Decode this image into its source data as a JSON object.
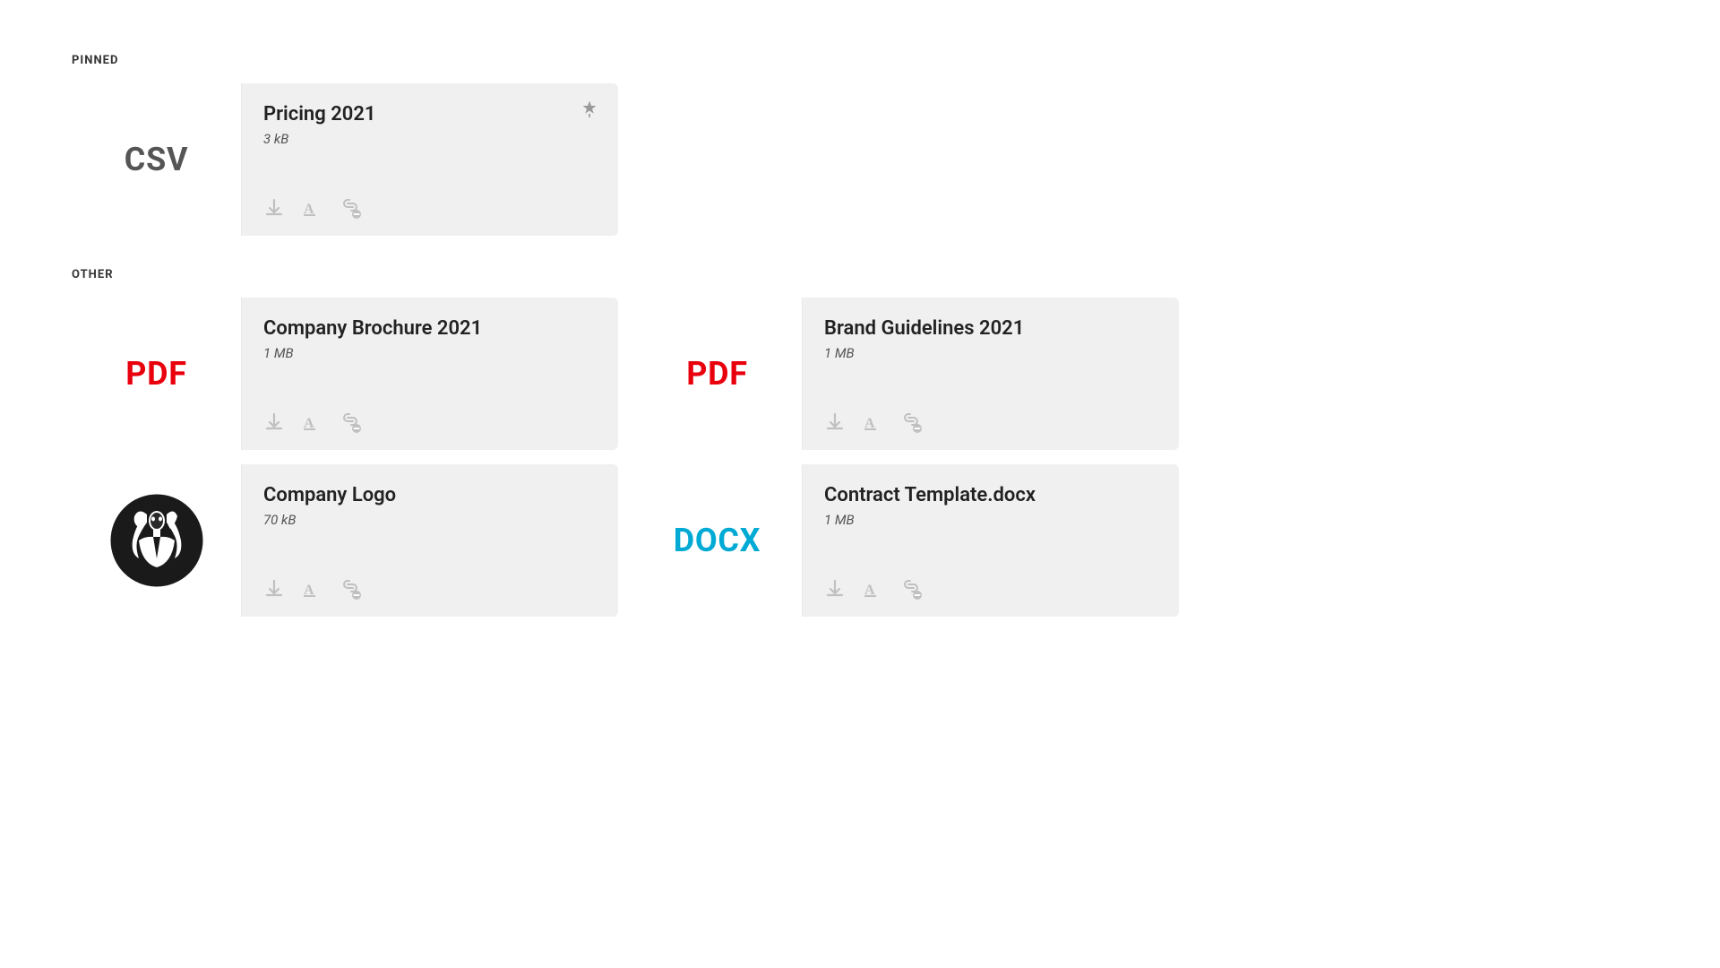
{
  "sections": {
    "pinned": {
      "label": "PINNED",
      "files": [
        {
          "id": "pricing-2021",
          "name": "Pricing 2021",
          "size": "3 kB",
          "type": "CSV",
          "typeClass": "file-type-csv",
          "pinned": true,
          "hasLogo": false
        }
      ]
    },
    "other": {
      "label": "OTHER",
      "files": [
        {
          "id": "company-brochure-2021",
          "name": "Company Brochure 2021",
          "size": "1 MB",
          "type": "PDF",
          "typeClass": "file-type-pdf",
          "pinned": false,
          "hasLogo": false
        },
        {
          "id": "brand-guidelines-2021",
          "name": "Brand Guidelines 2021",
          "size": "1 MB",
          "type": "PDF",
          "typeClass": "file-type-pdf",
          "pinned": false,
          "hasLogo": false
        },
        {
          "id": "company-logo",
          "name": "Company Logo",
          "size": "70 kB",
          "type": "IMG",
          "typeClass": "",
          "pinned": false,
          "hasLogo": true
        },
        {
          "id": "contract-template",
          "name": "Contract Template.docx",
          "size": "1 MB",
          "type": "DOCX",
          "typeClass": "file-type-docx",
          "pinned": false,
          "hasLogo": false
        }
      ]
    }
  },
  "actions": {
    "download": "download",
    "rename": "rename",
    "detach": "detach",
    "pin": "pin"
  }
}
